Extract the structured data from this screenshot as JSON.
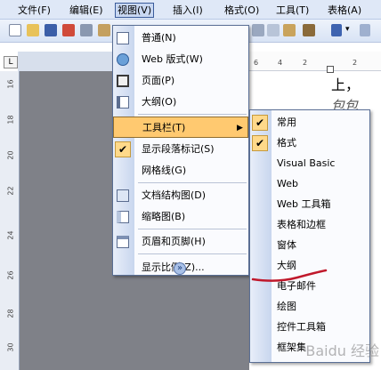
{
  "menubar": {
    "items": [
      "文件(F)",
      "编辑(E)",
      "视图(V)",
      "插入(I)",
      "格式(O)",
      "工具(T)",
      "表格(A)"
    ],
    "active_index": 2
  },
  "document": {
    "text_line1": "上，",
    "text_line2": "包包"
  },
  "ruler": {
    "corner_symbol": "L",
    "h_numbers": [
      "6",
      "4",
      "2",
      "2"
    ],
    "v_numbers": [
      "16",
      "18",
      "20",
      "22",
      "24",
      "26",
      "28",
      "30"
    ]
  },
  "view_menu": {
    "items": [
      {
        "label": "普通(N)",
        "icon": "normal-view-icon"
      },
      {
        "label": "Web 版式(W)",
        "icon": "web-layout-icon"
      },
      {
        "label": "页面(P)",
        "icon": "page-layout-icon"
      },
      {
        "label": "大纲(O)",
        "icon": "outline-icon"
      },
      {
        "label": "工具栏(T)",
        "icon": "",
        "submenu": true
      },
      {
        "label": "显示段落标记(S)",
        "icon": "check-icon",
        "checked": true
      },
      {
        "label": "网格线(G)",
        "icon": ""
      },
      {
        "label": "文档结构图(D)",
        "icon": "document-map-icon"
      },
      {
        "label": "缩略图(B)",
        "icon": "thumbnail-icon"
      },
      {
        "label": "页眉和页脚(H)",
        "icon": "header-footer-icon"
      },
      {
        "label": "显示比例(Z)...",
        "icon": ""
      }
    ],
    "expand_symbol": "»",
    "highlight_index": 4
  },
  "toolbars_submenu": {
    "items": [
      {
        "label": "常用",
        "checked": true
      },
      {
        "label": "格式",
        "checked": true
      },
      {
        "label": "Visual Basic",
        "checked": false
      },
      {
        "label": "Web",
        "checked": false
      },
      {
        "label": "Web 工具箱",
        "checked": false
      },
      {
        "label": "表格和边框",
        "checked": false
      },
      {
        "label": "窗体",
        "checked": false
      },
      {
        "label": "大纲",
        "checked": false
      },
      {
        "label": "电子邮件",
        "checked": false
      },
      {
        "label": "绘图",
        "checked": false
      },
      {
        "label": "控件工具箱",
        "checked": false
      },
      {
        "label": "框架集",
        "checked": false
      }
    ],
    "check_symbol": "✔"
  },
  "watermark": "Baidu 经验",
  "colors": {
    "highlight": "#ffc970",
    "menu_border": "#5a6f95",
    "red_mark": "#c0182b"
  }
}
